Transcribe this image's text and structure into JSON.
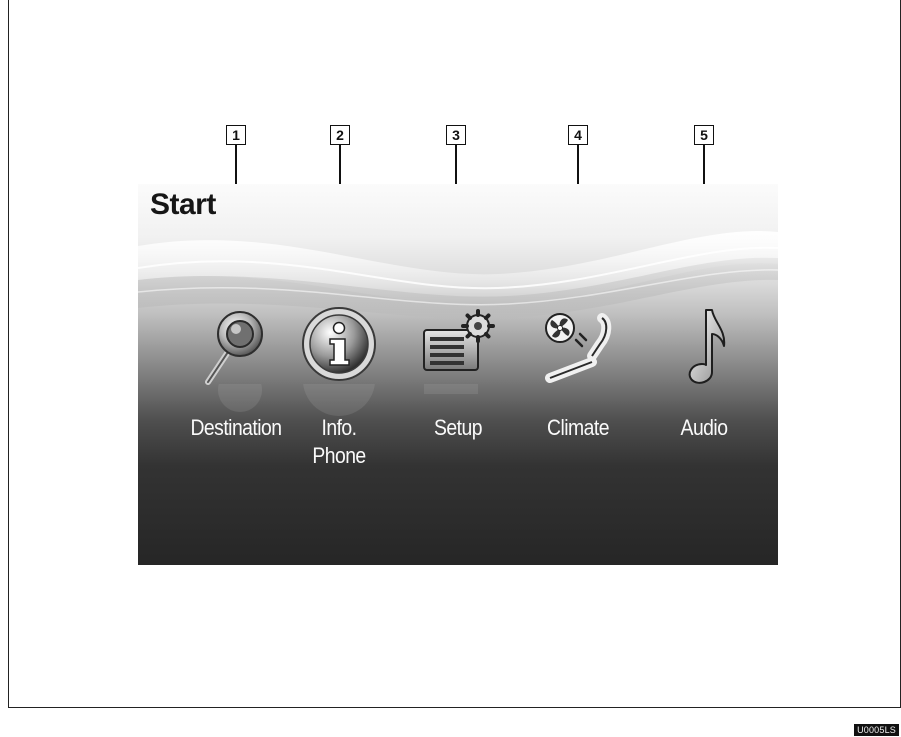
{
  "screen": {
    "title": "Start"
  },
  "menu": [
    {
      "callout": "1",
      "label": "Destination",
      "label2": "",
      "icon": "search-pin-icon"
    },
    {
      "callout": "2",
      "label": "Info.",
      "label2": "Phone",
      "icon": "info-icon"
    },
    {
      "callout": "3",
      "label": "Setup",
      "label2": "",
      "icon": "setup-gear-icon"
    },
    {
      "callout": "4",
      "label": "Climate",
      "label2": "",
      "icon": "climate-seat-fan-icon"
    },
    {
      "callout": "5",
      "label": "Audio",
      "label2": "",
      "icon": "music-note-icon"
    }
  ],
  "image_code": "U0005LS",
  "colors": {
    "screen_top": "#fbfbfb",
    "screen_bottom": "#262626",
    "label_text": "#fafafa",
    "callout_border": "#111111"
  }
}
